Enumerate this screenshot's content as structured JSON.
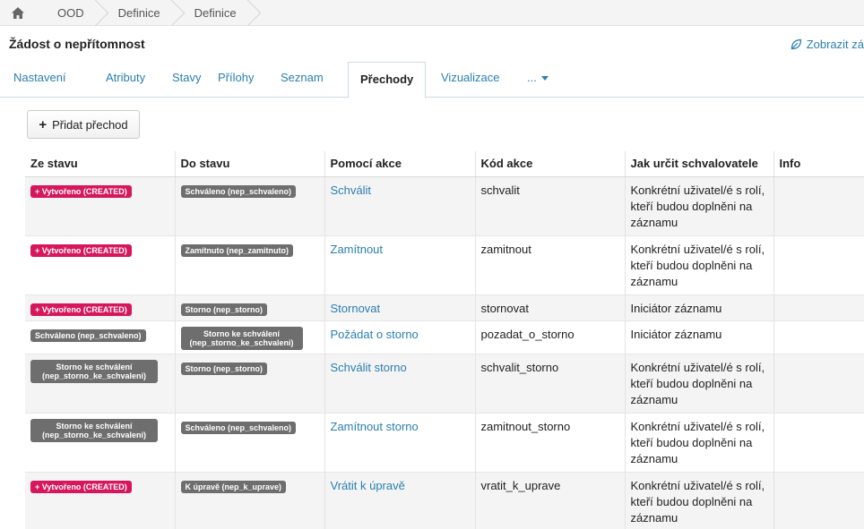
{
  "breadcrumb": {
    "items": [
      "OOD",
      "Definice",
      "Definice"
    ]
  },
  "header": {
    "title": "Žádost o nepřítomnost",
    "show_link": "Zobrazit zá"
  },
  "tabs": [
    "Nastavení",
    "Atributy",
    "Stavy",
    "Přílohy",
    "Seznam",
    "Přechody",
    "Vizualizace",
    "..."
  ],
  "active_tab": "Přechody",
  "add_button": "Přidat přechod",
  "table": {
    "headers": [
      "Ze stavu",
      "Do stavu",
      "Pomocí akce",
      "Kód akce",
      "Jak určit schvalovatele",
      "Info"
    ],
    "rows": [
      {
        "from": "+ Vytvořeno (CREATED)",
        "from_color": "pink",
        "to": "Schváleno (nep_schvaleno)",
        "action": "Schválit",
        "code": "schvalit",
        "approver": "Konkrétní uživatel/é s rolí, kteří budou doplněni na záznamu",
        "info": ""
      },
      {
        "from": "+ Vytvořeno (CREATED)",
        "from_color": "pink",
        "to": "Zamítnuto (nep_zamitnuto)",
        "action": "Zamítnout",
        "code": "zamitnout",
        "approver": "Konkrétní uživatel/é s rolí, kteří budou doplněni na záznamu",
        "info": ""
      },
      {
        "from": "+ Vytvořeno (CREATED)",
        "from_color": "pink",
        "to": "Storno (nep_storno)",
        "action": "Stornovat",
        "code": "stornovat",
        "approver": "Iniciátor záznamu",
        "info": ""
      },
      {
        "from": "Schváleno (nep_schvaleno)",
        "from_color": "grey",
        "to": "Storno ke schválení (nep_storno_ke_schvaleni)",
        "action": "Požádat o storno",
        "code": "pozadat_o_storno",
        "approver": "Iniciátor záznamu",
        "info": ""
      },
      {
        "from": "Storno ke schválení (nep_storno_ke_schvaleni)",
        "from_color": "grey",
        "to": "Storno (nep_storno)",
        "action": "Schválit storno",
        "code": "schvalit_storno",
        "approver": "Konkrétní uživatel/é s rolí, kteří budou doplněni na záznamu",
        "info": ""
      },
      {
        "from": "Storno ke schválení (nep_storno_ke_schvaleni)",
        "from_color": "grey",
        "to": "Schváleno (nep_schvaleno)",
        "action": "Zamítnout storno",
        "code": "zamitnout_storno",
        "approver": "Konkrétní uživatel/é s rolí, kteří budou doplněni na záznamu",
        "info": ""
      },
      {
        "from": "+ Vytvořeno (CREATED)",
        "from_color": "pink",
        "to": "K úpravě (nep_k_uprave)",
        "action": "Vrátit k úpravě",
        "code": "vratit_k_uprave",
        "approver": "Konkrétní uživatel/é s rolí, kteří budou doplněni na záznamu",
        "info": ""
      }
    ]
  },
  "colors": {
    "link": "#2a7fb0",
    "created_badge": "#d6175c",
    "state_badge": "#6e6e6e"
  },
  "icons": {
    "home": "home-icon",
    "show": "leaf-icon",
    "plus": "plus-icon",
    "caret": "caret-down-icon"
  }
}
